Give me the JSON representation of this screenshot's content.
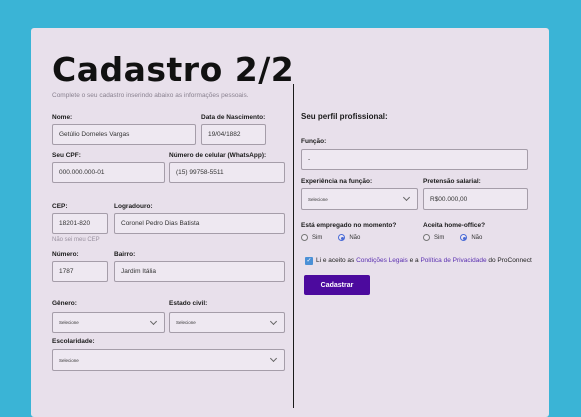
{
  "header": {
    "title": "Cadastro 2/2",
    "subtitle": "Complete o seu cadastro inserindo abaixo as informações pessoais."
  },
  "left": {
    "nome": {
      "label": "Nome:",
      "value": "Getúlio Dorneles Vargas"
    },
    "nascimento": {
      "label": "Data de Nascimento:",
      "value": "19/04/1882"
    },
    "cpf": {
      "label": "Seu CPF:",
      "value": "000.000.000-01"
    },
    "celular": {
      "label": "Número de celular (WhatsApp):",
      "value": "(15) 99758-5511"
    },
    "cep": {
      "label": "CEP:",
      "value": "18201-820",
      "hint": "Não sei meu CEP"
    },
    "logradouro": {
      "label": "Logradouro:",
      "value": "Coronel Pedro Dias Batista"
    },
    "numero": {
      "label": "Número:",
      "value": "1787"
    },
    "bairro": {
      "label": "Bairro:",
      "value": "Jardim Itália"
    },
    "genero": {
      "label": "Gênero:",
      "value": "Selecione"
    },
    "estado_civil": {
      "label": "Estado civil:",
      "value": "Selecione"
    },
    "escolaridade": {
      "label": "Escolaridade:",
      "value": "Selecione"
    }
  },
  "right": {
    "section_title": "Seu perfil profissional:",
    "funcao": {
      "label": "Função:",
      "value": "-"
    },
    "experiencia": {
      "label": "Experiência na função:",
      "value": "Selecione"
    },
    "pretensao": {
      "label": "Pretensão salarial:",
      "value": "R$00.000,00"
    },
    "empregado": {
      "label": "Está empregado no momento?",
      "opt_yes": "Sim",
      "opt_no": "Não",
      "selected": "Não"
    },
    "homeoffice": {
      "label": "Aceita home-office?",
      "opt_yes": "Sim",
      "opt_no": "Não",
      "selected": "Não"
    },
    "terms": {
      "prefix": "Li e aceito as ",
      "link1": "Condições Legais",
      "middle": " e a ",
      "link2": "Política de Privacidade",
      "suffix": " do ProConnect",
      "checked": true
    },
    "submit_label": "Cadastrar"
  },
  "colors": {
    "background": "#3ab4d6",
    "card": "#e8e0eb",
    "button": "#4c0a9e",
    "link": "#5a2fb0",
    "radio_selected": "#4a6bd6"
  }
}
